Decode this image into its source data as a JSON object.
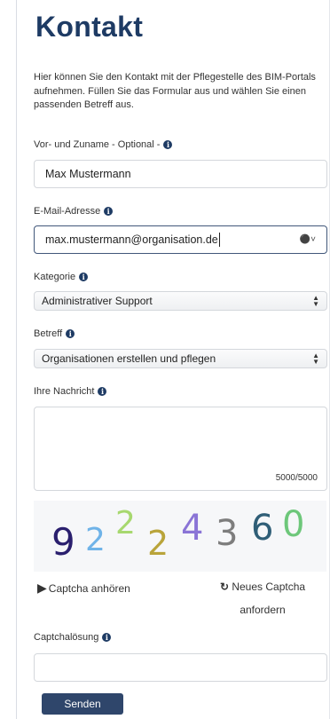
{
  "page": {
    "title": "Kontakt",
    "intro": "Hier können Sie den Kontakt mit der Pflegestelle des BIM-Portals aufnehmen. Füllen Sie das Formular aus und wählen Sie einen passenden Betreff aus."
  },
  "form": {
    "name": {
      "label": "Vor- und Zuname - Optional -",
      "value": "Max Mustermann"
    },
    "email": {
      "label": "E-Mail-Adresse",
      "value": "max.mustermann@organisation.de",
      "icon": "password-manager-icon"
    },
    "category": {
      "label": "Kategorie",
      "selected": "Administrativer Support"
    },
    "subject": {
      "label": "Betreff",
      "selected": "Organisationen erstellen und pflegen"
    },
    "message": {
      "label": "Ihre Nachricht",
      "value": "",
      "counter": "5000/5000"
    },
    "captcha": {
      "digits": [
        "9",
        "2",
        "2",
        "2",
        "4",
        "3",
        "6",
        "0"
      ],
      "colors": [
        "#2a1f6e",
        "#6fb3e8",
        "#a7d86f",
        "#b9a43a",
        "#8a74d6",
        "#7d7d7d",
        "#2f5e77",
        "#6dc77a"
      ],
      "listen_label": "Captcha anhören",
      "refresh_label": "Neues Captcha anfordern"
    },
    "solution": {
      "label": "Captchalösung",
      "value": ""
    },
    "submit_label": "Senden"
  }
}
